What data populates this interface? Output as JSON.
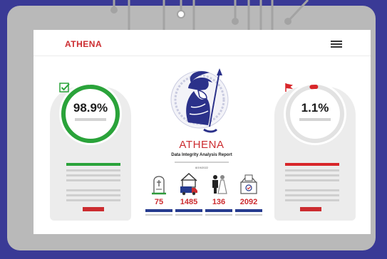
{
  "header": {
    "brand": "ATHENA",
    "menu_icon": "hamburger-menu-icon"
  },
  "report": {
    "title": "ATHENA",
    "subtitle": "Data Integrity Analysis Report",
    "date": "8/19/2022"
  },
  "left_card": {
    "value": "98.9%",
    "percent": 98.9,
    "icon": "checkbox-check-icon",
    "accent": "#2aa33a"
  },
  "right_card": {
    "value": "1.1%",
    "percent": 1.1,
    "icon": "red-flag-icon",
    "accent": "#d8262a"
  },
  "stats": [
    {
      "icon": "gravestone-icon",
      "value": "75"
    },
    {
      "icon": "moving-truck-house-icon",
      "value": "1485"
    },
    {
      "icon": "couple-icon",
      "value": "136"
    },
    {
      "icon": "ballot-box-icon",
      "value": "2092"
    }
  ],
  "colors": {
    "background": "#3a3a96",
    "red": "#cc2c30",
    "green": "#2aa33a",
    "navy": "#263b8f"
  }
}
